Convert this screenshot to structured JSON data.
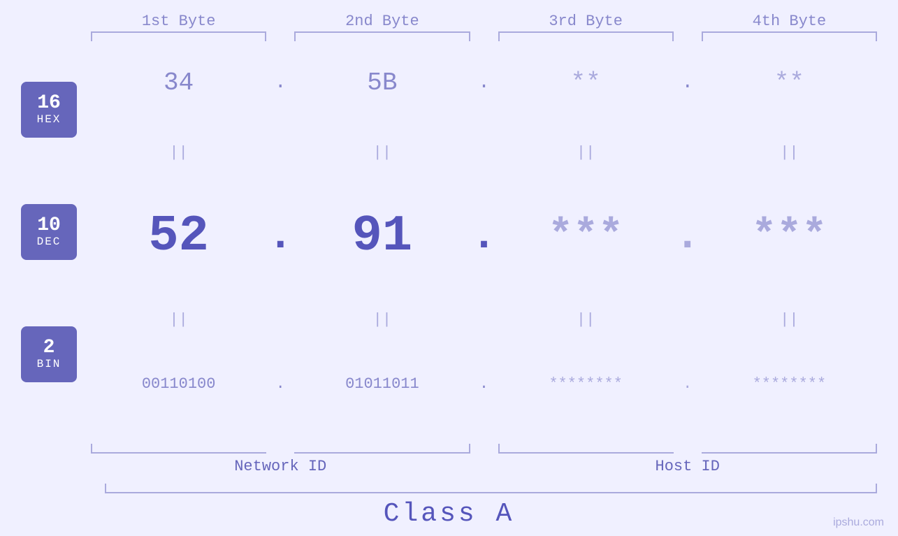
{
  "bytes": {
    "headers": [
      "1st Byte",
      "2nd Byte",
      "3rd Byte",
      "4th Byte"
    ]
  },
  "bases": [
    {
      "number": "16",
      "label": "HEX"
    },
    {
      "number": "10",
      "label": "DEC"
    },
    {
      "number": "2",
      "label": "BIN"
    }
  ],
  "hex_row": {
    "b1": "34",
    "b2": "5B",
    "b3": "**",
    "b4": "**",
    "dots": [
      ".",
      ".",
      "."
    ]
  },
  "dec_row": {
    "b1": "52",
    "b2": "91",
    "b3": "***",
    "b4": "***",
    "dots": [
      ".",
      ".",
      "."
    ]
  },
  "bin_row": {
    "b1": "00110100",
    "b2": "01011011",
    "b3": "********",
    "b4": "********",
    "dots": [
      ".",
      ".",
      "."
    ]
  },
  "labels": {
    "network_id": "Network ID",
    "host_id": "Host ID",
    "class": "Class A"
  },
  "watermark": "ipshu.com",
  "separators": [
    "||",
    "||",
    "||",
    "||"
  ]
}
